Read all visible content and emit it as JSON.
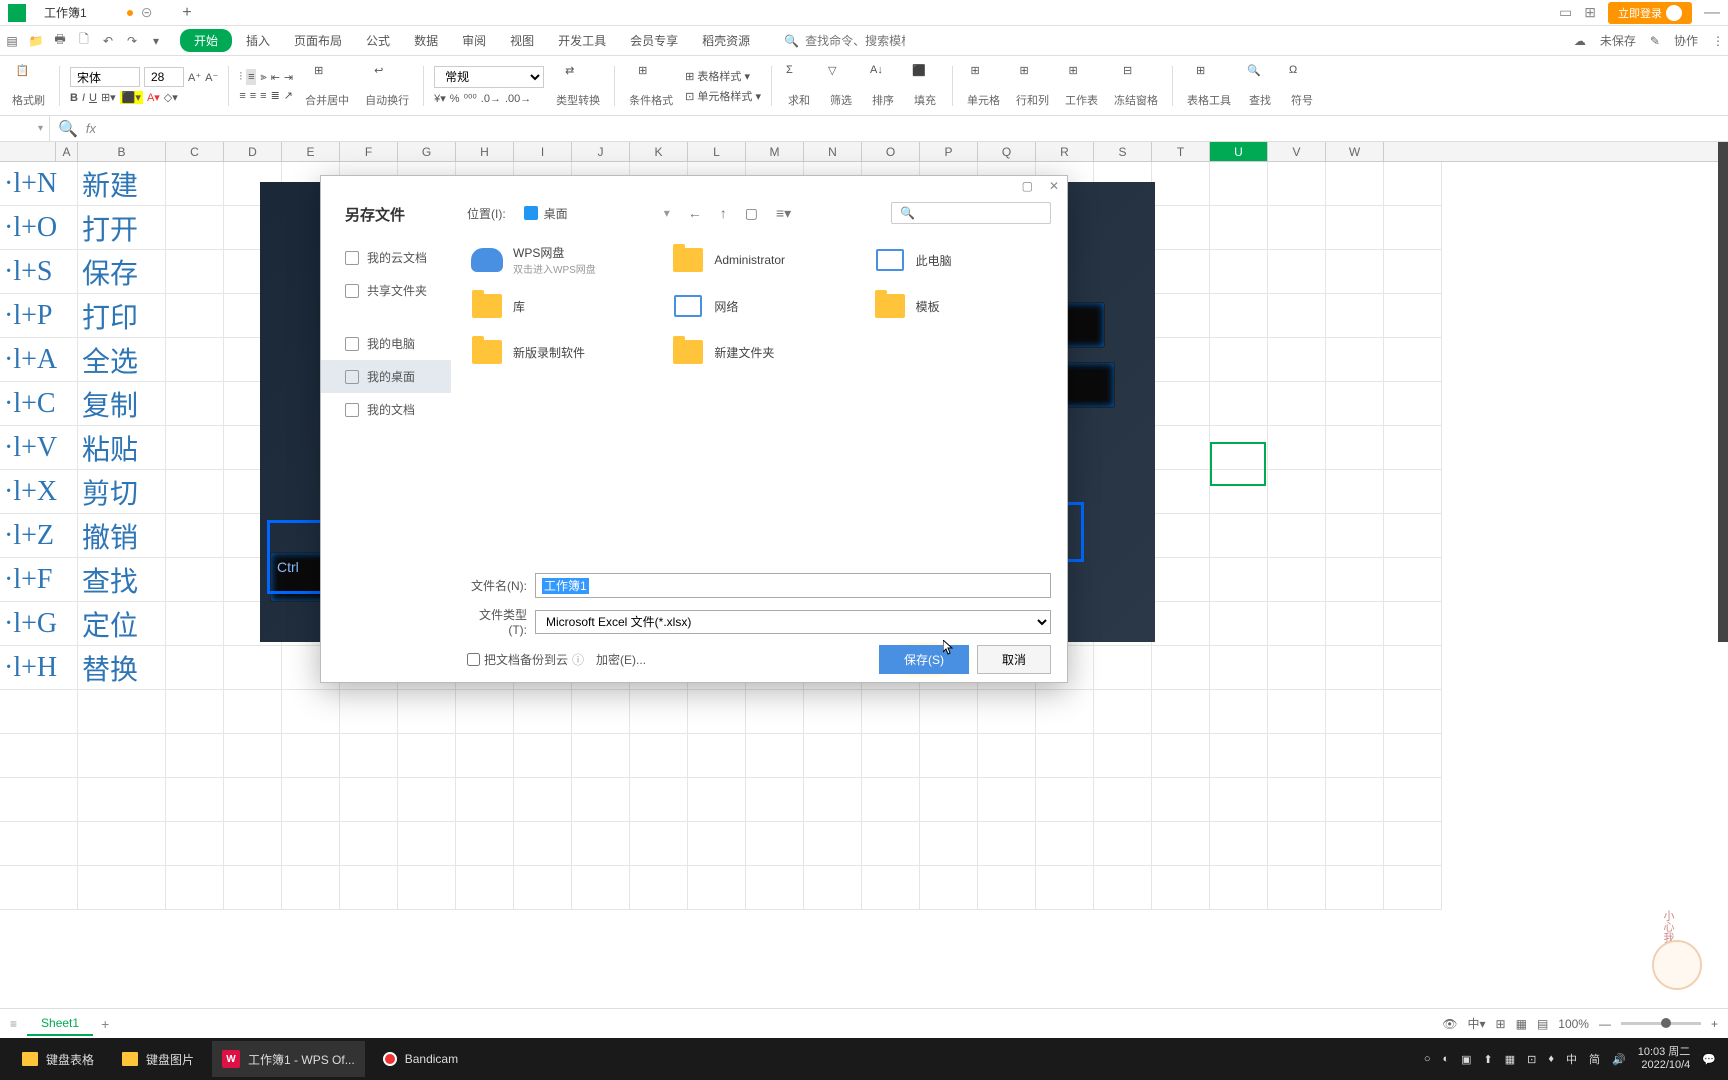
{
  "titlebar": {
    "tab_name": "工作簿1",
    "login": "立即登录"
  },
  "menubar": {
    "tabs": [
      "开始",
      "插入",
      "页面布局",
      "公式",
      "数据",
      "审阅",
      "视图",
      "开发工具",
      "会员专享",
      "稻壳资源"
    ],
    "search_placeholder": "查找命令、搜索模板",
    "unsaved": "未保存",
    "collab": "协作"
  },
  "ribbon": {
    "paste": "格式刷",
    "font": "宋体",
    "size": "28",
    "format": "常规",
    "merge": "合并居中",
    "wrap": "自动换行",
    "type": "类型转换",
    "cond": "条件格式",
    "cellstyle": "单元格样式",
    "sum": "求和",
    "filter": "筛选",
    "sort": "排序",
    "fill": "填充",
    "cell": "单元格",
    "rowcol": "行和列",
    "sheet": "工作表",
    "freeze": "冻结窗格",
    "tools": "表格工具",
    "find": "查找",
    "symbol": "符号",
    "tblfmt": "表格样式"
  },
  "column_headers": [
    "A",
    "B",
    "C",
    "D",
    "E",
    "F",
    "G",
    "H",
    "I",
    "J",
    "K",
    "L",
    "M",
    "N",
    "O",
    "P",
    "Q",
    "R",
    "S",
    "T",
    "U",
    "V",
    "W"
  ],
  "cells": [
    {
      "a": "·l+N",
      "b": "新建"
    },
    {
      "a": "·l+O",
      "b": "打开"
    },
    {
      "a": "·l+S",
      "b": "保存"
    },
    {
      "a": "·l+P",
      "b": "打印"
    },
    {
      "a": "·l+A",
      "b": "全选"
    },
    {
      "a": "·l+C",
      "b": "复制"
    },
    {
      "a": "·l+V",
      "b": "粘贴"
    },
    {
      "a": "·l+X",
      "b": "剪切"
    },
    {
      "a": "·l+Z",
      "b": "撤销"
    },
    {
      "a": "·l+F",
      "b": "查找"
    },
    {
      "a": "·l+G",
      "b": "定位"
    },
    {
      "a": "·l+H",
      "b": "替换"
    }
  ],
  "dialog": {
    "title": "另存文件",
    "loc_label": "位置(I):",
    "loc_value": "桌面",
    "sidebar": [
      "我的云文档",
      "共享文件夹",
      "我的电脑",
      "我的桌面",
      "我的文档"
    ],
    "files": [
      {
        "name": "WPS网盘",
        "sub": "双击进入WPS网盘",
        "icon": "cloud"
      },
      {
        "name": "Administrator",
        "icon": "folder"
      },
      {
        "name": "此电脑",
        "icon": "pc"
      },
      {
        "name": "库",
        "icon": "folder"
      },
      {
        "name": "网络",
        "icon": "network"
      },
      {
        "name": "模板",
        "icon": "folder"
      },
      {
        "name": "新版录制软件",
        "icon": "folder"
      },
      {
        "name": "新建文件夹",
        "icon": "folder"
      }
    ],
    "fname_label": "文件名(N):",
    "fname_value": "工作簿1",
    "ftype_label": "文件类型(T):",
    "ftype_value": "Microsoft Excel 文件(*.xlsx)",
    "backup": "把文档备份到云",
    "encrypt": "加密(E)...",
    "save": "保存(S)",
    "cancel": "取消"
  },
  "sheets": {
    "name": "Sheet1",
    "zoom": "100%"
  },
  "taskbar": {
    "items": [
      "键盘表格",
      "键盘图片",
      "工作簿1 - WPS Of...",
      "Bandicam"
    ],
    "ime": [
      "中",
      "简"
    ],
    "time": "10:03",
    "day": "周二",
    "date": "2022/10/4"
  },
  "mascot": "小心我们走"
}
